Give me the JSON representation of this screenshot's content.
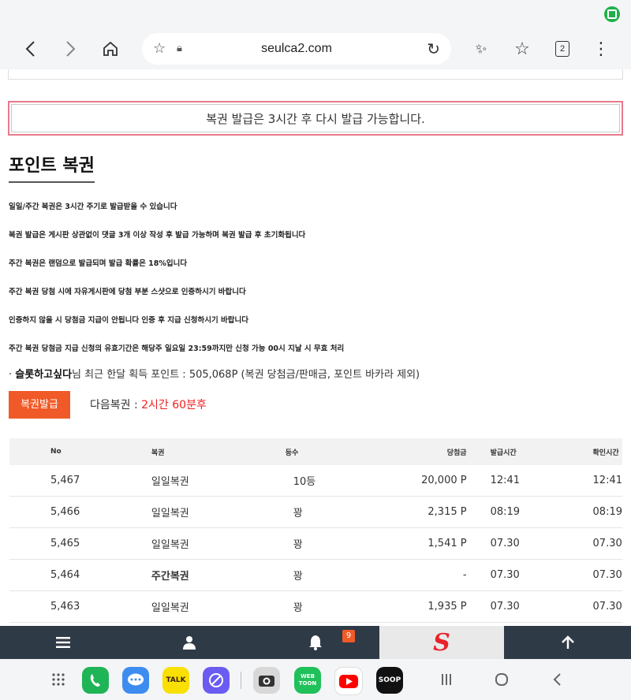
{
  "browser": {
    "url": "seulca2.com",
    "tab_count": "2"
  },
  "notice": "복권 발급은 3시간 후 다시 발급 가능합니다.",
  "section_title": "포인트 복권",
  "info_lines": [
    "일일/주간 복권은 3시간 주기로 발급받을 수 있습니다",
    "복권 발급은 게시판 상관없이 댓글 3개 이상 작성 후 발급 가능하며 복권 발급 후 초기화됩니다",
    "주간 복권은 랜덤으로 발급되며 발급 확률은 18%입니다",
    "주간 복권 당첨 시에 자유게시판에 당첨 부분 스샷으로 인증하시기 바랍니다",
    "인증하지 않을 시 당첨금 지급이 안됩니다 인증 후 지급 신청하시기 바랍니다",
    "주간 복권 당첨금 지급 신청의 유효기간은 해당주 일요일 23:59까지만 신청 가능 00시 지날 시 무효 처리"
  ],
  "summary": {
    "bullet": "·",
    "username": "슬롯하고싶다",
    "suffix": "님 최근 한달 획득 포인트 : 505,068P (복권 당첨금/판매금, 포인트 바카라 제외)"
  },
  "issue_button": "복권발급",
  "next_lottery": {
    "label": "다음복권 : ",
    "value": "2시간 60분후"
  },
  "table": {
    "headers": [
      "No",
      "복권",
      "등수",
      "당첨금",
      "발급시간",
      "확인시간"
    ],
    "rows": [
      {
        "no": "5,467",
        "name": "일일복권",
        "rank": "10등",
        "prize": "20,000 P",
        "issued": "12:41",
        "checked": "12:41",
        "bold": false
      },
      {
        "no": "5,466",
        "name": "일일복권",
        "rank": "꽝",
        "prize": "2,315 P",
        "issued": "08:19",
        "checked": "08:19",
        "bold": false
      },
      {
        "no": "5,465",
        "name": "일일복권",
        "rank": "꽝",
        "prize": "1,541 P",
        "issued": "07.30",
        "checked": "07.30",
        "bold": false
      },
      {
        "no": "5,464",
        "name": "주간복권",
        "rank": "꽝",
        "prize": "-",
        "issued": "07.30",
        "checked": "07.30",
        "bold": true
      },
      {
        "no": "5,463",
        "name": "일일복권",
        "rank": "꽝",
        "prize": "1,935 P",
        "issued": "07.30",
        "checked": "07.30",
        "bold": false
      }
    ]
  },
  "bottom_nav": {
    "notification_count": "9",
    "logo_letter": "S"
  },
  "dock": {
    "talk_label": "TALK",
    "webtoon_label": "WEB TOON",
    "soop_label": "SOOP"
  },
  "colors": {
    "accent": "#f05a28",
    "notice_border": "#e87a8a",
    "nav_bg": "#2f3a47",
    "next_value": "#f02020"
  }
}
